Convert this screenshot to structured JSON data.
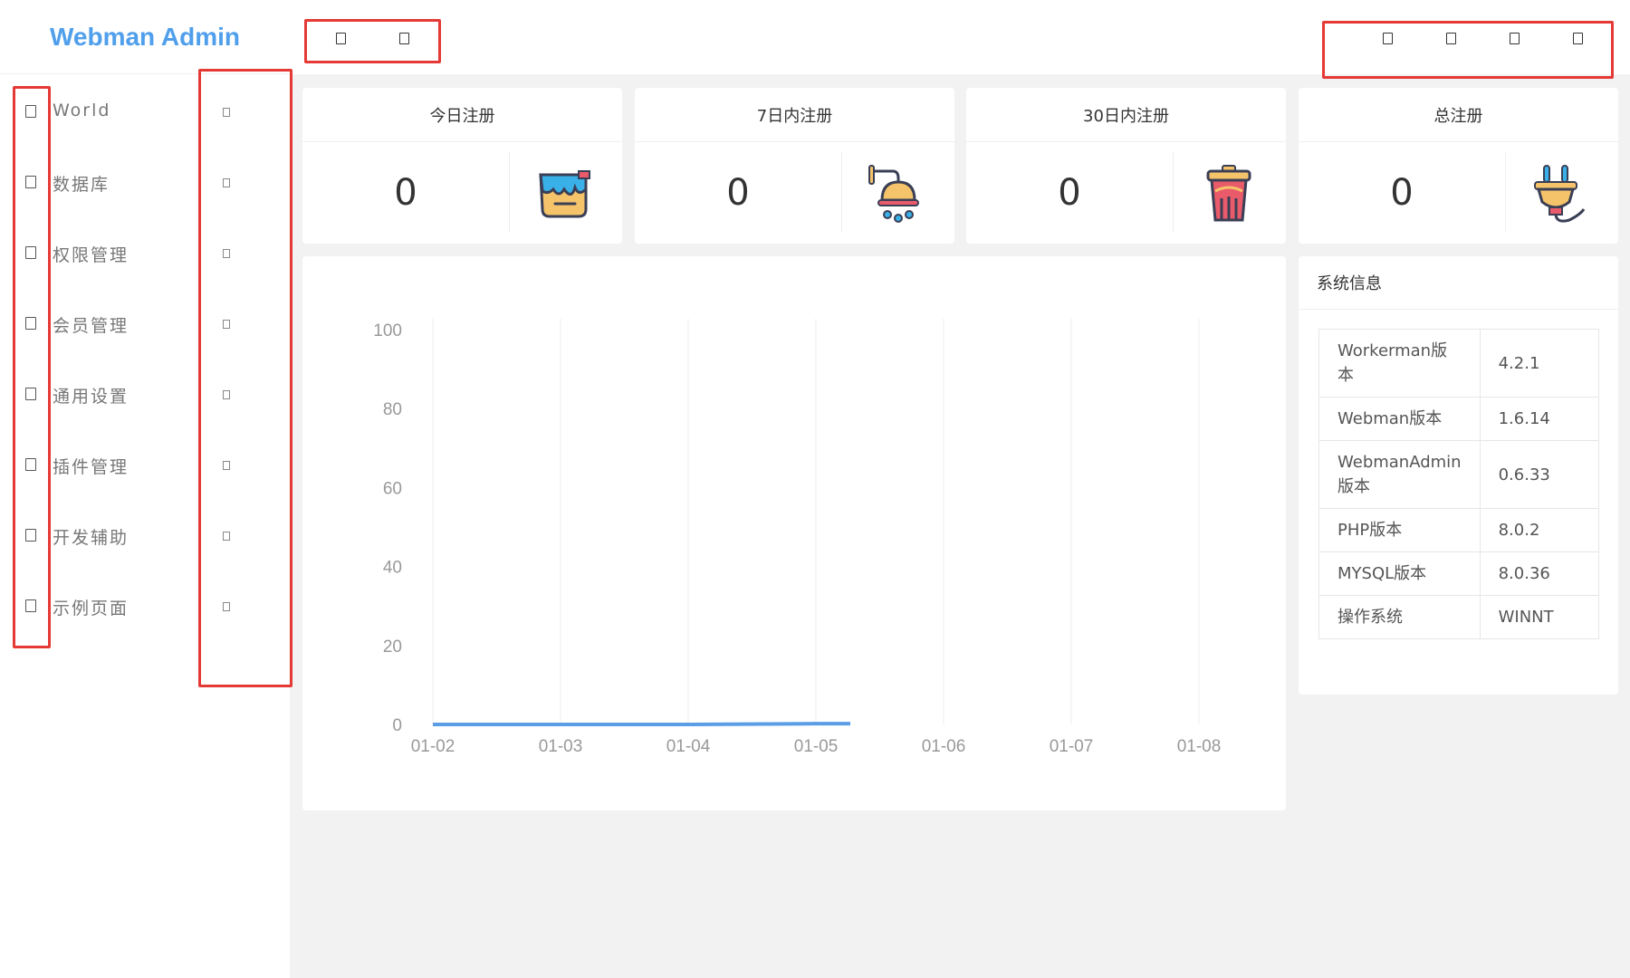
{
  "app": {
    "title": "Webman Admin"
  },
  "sidebar": {
    "items": [
      {
        "label": "World",
        "icon": "menu-icon"
      },
      {
        "label": "数据库",
        "icon": "menu-icon"
      },
      {
        "label": "权限管理",
        "icon": "menu-icon"
      },
      {
        "label": "会员管理",
        "icon": "menu-icon"
      },
      {
        "label": "通用设置",
        "icon": "menu-icon"
      },
      {
        "label": "插件管理",
        "icon": "menu-icon"
      },
      {
        "label": "开发辅助",
        "icon": "menu-icon"
      },
      {
        "label": "示例页面",
        "icon": "menu-icon"
      }
    ]
  },
  "header": {
    "left_icons": [
      "menu-toggle-icon",
      "refresh-icon"
    ],
    "right_icons": [
      "theme-icon",
      "fullscreen-icon",
      "user-icon",
      "more-icon"
    ]
  },
  "stats": [
    {
      "title": "今日注册",
      "value": "0",
      "icon": "paint-bucket-icon"
    },
    {
      "title": "7日内注册",
      "value": "0",
      "icon": "shower-icon"
    },
    {
      "title": "30日内注册",
      "value": "0",
      "icon": "trash-can-icon"
    },
    {
      "title": "总注册",
      "value": "0",
      "icon": "plug-icon"
    }
  ],
  "chart_data": {
    "type": "line",
    "categories": [
      "01-02",
      "01-03",
      "01-04",
      "01-05",
      "01-06",
      "01-07",
      "01-08"
    ],
    "series": [
      {
        "values": [
          0,
          0,
          0,
          0.2
        ]
      }
    ],
    "ylim": [
      0,
      100
    ],
    "yticks": [
      0,
      20,
      40,
      60,
      80,
      100
    ],
    "grid": "vertical",
    "colors": {
      "line": "#5b9ee6",
      "axis": "#999999",
      "grid": "#eeeeee"
    }
  },
  "system_info": {
    "title": "系统信息",
    "rows": [
      {
        "key": "Workerman版本",
        "value": "4.2.1"
      },
      {
        "key": "Webman版本",
        "value": "1.6.14"
      },
      {
        "key": "WebmanAdmin版本",
        "value": "0.6.33"
      },
      {
        "key": "PHP版本",
        "value": "8.0.2"
      },
      {
        "key": "MYSQL版本",
        "value": "8.0.36"
      },
      {
        "key": "操作系统",
        "value": "WINNT"
      }
    ]
  },
  "colors": {
    "brand": "#4f9fec",
    "annotation": "#e53935",
    "background": "#f2f2f2"
  }
}
